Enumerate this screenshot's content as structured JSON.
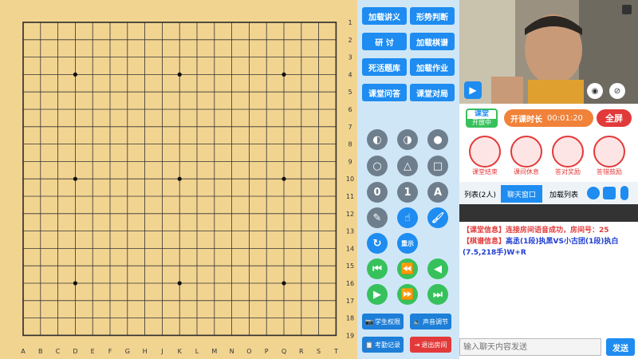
{
  "board": {
    "cols": [
      "A",
      "B",
      "C",
      "D",
      "E",
      "F",
      "G",
      "H",
      "J",
      "K",
      "L",
      "M",
      "N",
      "O",
      "P",
      "Q",
      "R",
      "S",
      "T"
    ],
    "rows": [
      "1",
      "2",
      "3",
      "4",
      "5",
      "6",
      "7",
      "8",
      "9",
      "10",
      "11",
      "12",
      "13",
      "14",
      "15",
      "16",
      "17",
      "18",
      "19"
    ],
    "star_points": [
      [
        "D",
        "4"
      ],
      [
        "K",
        "4"
      ],
      [
        "Q",
        "4"
      ],
      [
        "D",
        "10"
      ],
      [
        "K",
        "10"
      ],
      [
        "Q",
        "10"
      ],
      [
        "D",
        "16"
      ],
      [
        "K",
        "16"
      ],
      [
        "Q",
        "16"
      ]
    ],
    "color": "#f2d491"
  },
  "controls": {
    "buttons": [
      "加载讲义",
      "形势判断",
      "研 讨",
      "加载棋谱",
      "死活题库",
      "加载作业",
      "课堂问答",
      "课堂对局"
    ],
    "tools": [
      "◐",
      "◑",
      "●",
      "○",
      "△",
      "□",
      "0",
      "1",
      "A",
      "✎",
      "☝",
      "🖌",
      "↻",
      "重示",
      "⏮",
      "⏪",
      "◀",
      "▶",
      "⏩",
      "⏭"
    ],
    "bottom": [
      "学生权限",
      "声音调节",
      "考勤记录",
      "退出房间"
    ]
  },
  "status": {
    "badge_top": "课堂",
    "badge_bottom": "开放中",
    "timer_label": "开课时长",
    "timer_value": "00:01:20",
    "fullscreen": "全屏",
    "actions": [
      "课堂结束",
      "课间休息",
      "答对奖励",
      "答错鼓励"
    ]
  },
  "tabs": {
    "list": "列表(2人)",
    "chat": "聊天窗口",
    "load_list": "加载列表"
  },
  "chat": {
    "line1_tag": "【课堂信息】",
    "line1_text": "连接房间语音成功，房间号：25",
    "line2_tag": "【棋谱信息】",
    "line2_text": "高丞(1段)执黑VS小古团(1段)执白(7.5,218手)W+R"
  },
  "input": {
    "placeholder": "输入聊天内容发送",
    "send": "发送"
  },
  "colors": {
    "accent_blue": "#1e8cf0",
    "accent_red": "#e23a3a",
    "accent_green": "#37c15c",
    "timer_orange": "#f0823a"
  }
}
